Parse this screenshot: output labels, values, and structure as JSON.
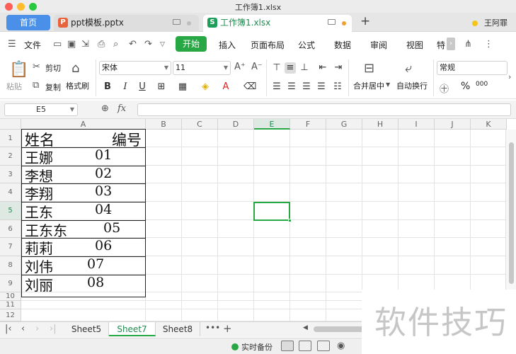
{
  "window": {
    "title": "工作簿1.xlsx"
  },
  "tabs": {
    "home": "首页",
    "docs": [
      {
        "label": "ppt模板.pptx",
        "icon": "ppt-file-icon",
        "active": false
      },
      {
        "label": "工作簿1.xlsx",
        "icon": "xls-file-icon",
        "active": true
      }
    ],
    "new_tab": "+",
    "user": "王阿罪"
  },
  "menu": {
    "file": "文件",
    "items": [
      "开始",
      "插入",
      "页面布局",
      "公式",
      "数据",
      "审阅",
      "视图",
      "特"
    ],
    "active": "开始"
  },
  "ribbon": {
    "paste": "粘贴",
    "cut": "剪切",
    "copy": "复制",
    "format_painter": "格式刷",
    "font_name": "宋体",
    "font_size": "11",
    "merge_center": "合并居中",
    "wrap_text": "自动换行",
    "number_format": "常规",
    "percent": "%",
    "thousands": "000"
  },
  "formula_bar": {
    "name_box": "E5",
    "fx": "fx",
    "value": ""
  },
  "sheet": {
    "columns": [
      "A",
      "B",
      "C",
      "D",
      "E",
      "F",
      "G",
      "H",
      "I",
      "J",
      "K"
    ],
    "rows": [
      "1",
      "2",
      "3",
      "4",
      "5",
      "6",
      "7",
      "8",
      "9",
      "10",
      "11",
      "12"
    ],
    "active_cell": "E5",
    "header": {
      "name": "姓名",
      "number": "编号"
    },
    "records": [
      {
        "name": "王娜",
        "number": "01"
      },
      {
        "name": "李想",
        "number": "02"
      },
      {
        "name": "李翔",
        "number": "03"
      },
      {
        "name": "王东",
        "number": "04"
      },
      {
        "name": "王东东",
        "number": "05"
      },
      {
        "name": "莉莉",
        "number": "06"
      },
      {
        "name": "刘伟",
        "number": "07"
      },
      {
        "name": "刘丽",
        "number": "08"
      }
    ]
  },
  "sheet_tabs": {
    "items": [
      "Sheet5",
      "Sheet7",
      "Sheet8"
    ],
    "active": "Sheet7",
    "more": "•••",
    "add": "+"
  },
  "status": {
    "backup": "实时备份"
  },
  "watermark": "软件技巧",
  "colors": {
    "accent": "#28a745",
    "brand_blue": "#4a90e8",
    "ppt_orange": "#e8633c"
  }
}
